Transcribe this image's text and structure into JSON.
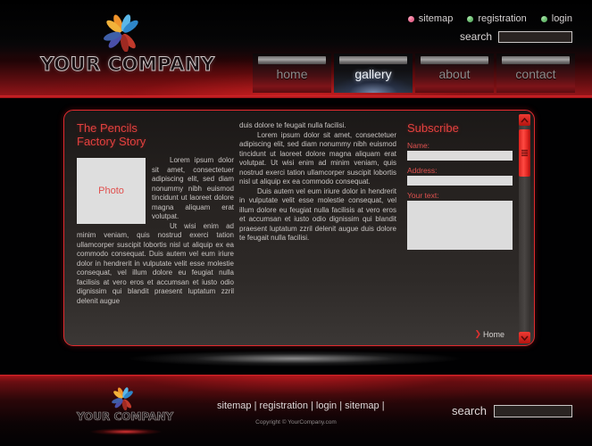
{
  "colors": {
    "accent_red": "#e02a2e",
    "panel_bg": "#2a2624",
    "input_bg": "#dcdcdc",
    "bullet_pink": "#d6255c",
    "bullet_green": "#1e8c2a"
  },
  "header": {
    "company_name": "YOUR COMPANY",
    "logo_icon": "flower-logo",
    "top_links": [
      {
        "label": "sitemap",
        "bullet": "pink"
      },
      {
        "label": "registration",
        "bullet": "green"
      },
      {
        "label": "login",
        "bullet": "green"
      }
    ],
    "search": {
      "label": "search",
      "value": "",
      "placeholder": ""
    },
    "nav": [
      {
        "label": "home",
        "active": false
      },
      {
        "label": "gallery",
        "active": true
      },
      {
        "label": "about",
        "active": false
      },
      {
        "label": "contact",
        "active": false
      }
    ]
  },
  "content": {
    "story": {
      "title_line1": "The Pencils",
      "title_line2": "Factory Story",
      "photo_label": "Photo",
      "paragraph1": "Lorem ipsum dolor sit amet, consectetuer adipiscing elit, sed diam nonummy nibh euismod tincidunt ut laoreet dolore magna aliquam erat volutpat.",
      "paragraph2": "Ut wisi enim ad minim veniam, quis nostrud exerci tation ullamcorper suscipit lobortis nisl ut aliquip ex ea commodo consequat. Duis autem vel eum iriure dolor in hendrerit in vulputate velit esse molestie consequat, vel illum dolore eu feugiat nulla facilisis at vero eros et accumsan et iusto odio dignissim qui blandit praesent luptatum zzril delenit augue"
    },
    "middle": {
      "paragraph1": "duis dolore te feugait nulla facilisi.",
      "paragraph2": "Lorem ipsum dolor sit amet, consectetuer adipiscing elit, sed diam nonummy nibh euismod tincidunt ut laoreet dolore magna aliquam erat volutpat. Ut wisi enim ad minim veniam, quis nostrud exerci tation ullamcorper suscipit lobortis nisl ut aliquip ex ea commodo consequat.",
      "paragraph3": "Duis autem vel eum iriure dolor in hendrerit in vulputate velit esse molestie consequat, vel illum dolore eu feugiat nulla facilisis at vero eros et accumsan et iusto odio dignissim qui blandit praesent luptatum zzril delenit augue duis dolore te feugait nulla facilisi."
    },
    "subscribe": {
      "title": "Subscribe",
      "name_label": "Name:",
      "name_value": "",
      "address_label": "Address:",
      "address_value": "",
      "text_label": "Your text:",
      "text_value": ""
    },
    "home_link": {
      "chevron": "chevron-right-icon",
      "label": "Home"
    },
    "scrollbar": {
      "up_icon": "chevron-up-icon",
      "down_icon": "chevron-down-icon"
    }
  },
  "footer": {
    "company_name": "YOUR COMPANY",
    "logo_icon": "flower-logo",
    "links": [
      "sitemap",
      "registration",
      "login",
      "sitemap"
    ],
    "separator": "|",
    "copyright": "Copyright © YourCompany.com",
    "search": {
      "label": "search",
      "value": "",
      "placeholder": ""
    }
  }
}
